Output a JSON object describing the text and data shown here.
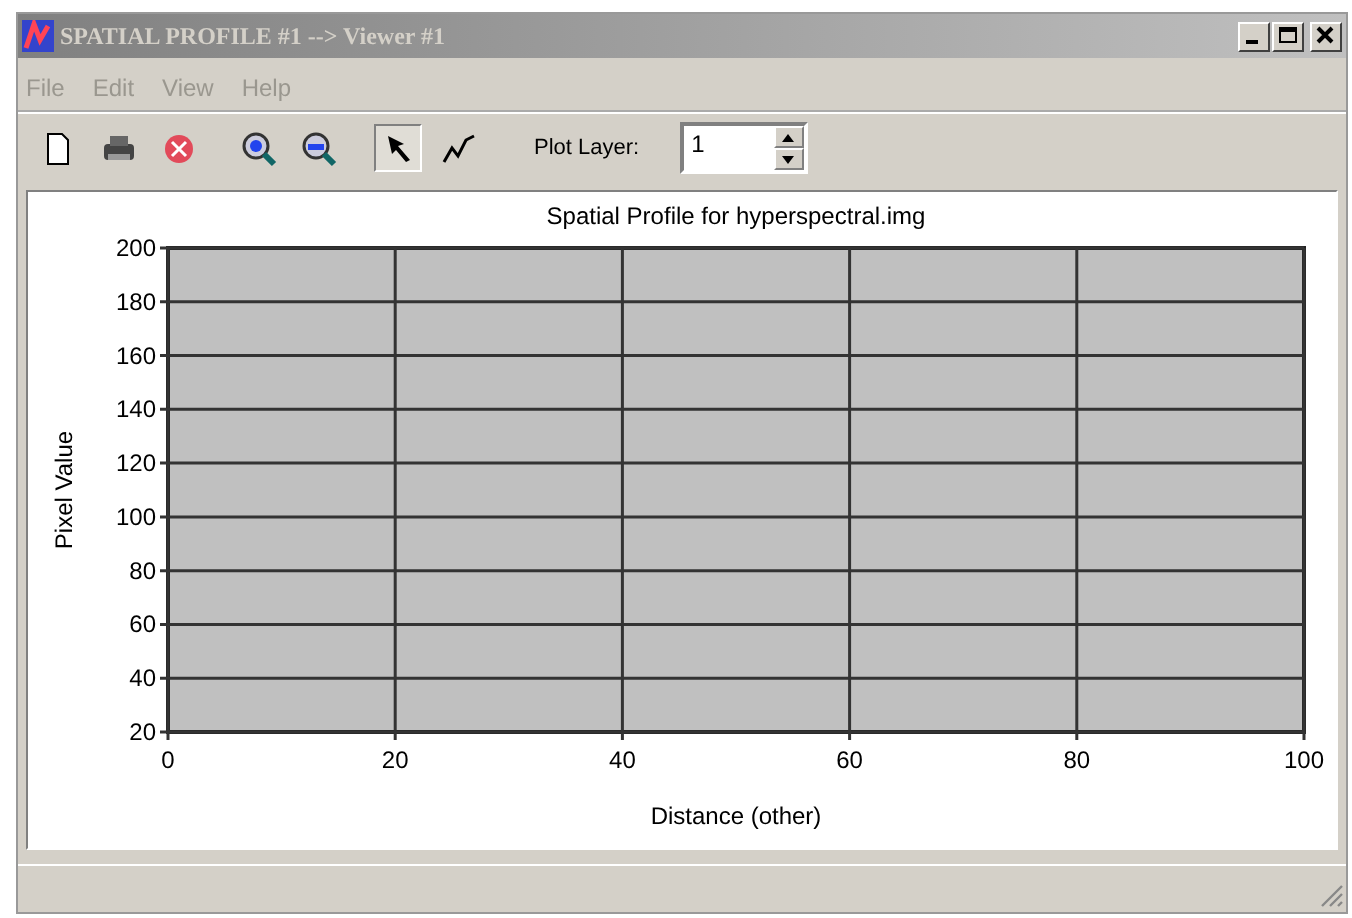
{
  "window": {
    "title": "SPATIAL PROFILE #1 --> Viewer #1",
    "active": false
  },
  "menu": [
    {
      "label": "File"
    },
    {
      "label": "Edit"
    },
    {
      "label": "View"
    },
    {
      "label": "Help"
    }
  ],
  "toolbar": [
    {
      "kind": "new",
      "selected": false
    },
    {
      "kind": "print",
      "selected": false
    },
    {
      "kind": "stop",
      "selected": false
    },
    {
      "kind": "zoom-in",
      "selected": false
    },
    {
      "kind": "zoom-out",
      "selected": false
    },
    {
      "kind": "pointer",
      "selected": true
    },
    {
      "kind": "line",
      "selected": false
    }
  ],
  "plot_layer": {
    "label": "Plot Layer:",
    "value": "1"
  },
  "chart": {
    "chart_data": {
      "type": "line",
      "title": "Spatial Profile for hyperspectral.img",
      "xlabel": "Distance (other)",
      "ylabel": "Pixel Value",
      "xlim": [
        0,
        100
      ],
      "ylim": [
        20,
        200
      ],
      "xticks": [
        0,
        20,
        40,
        60,
        80,
        100
      ],
      "yticks": [
        20,
        40,
        60,
        80,
        100,
        120,
        140,
        160,
        180,
        200
      ],
      "grid": true
    }
  }
}
